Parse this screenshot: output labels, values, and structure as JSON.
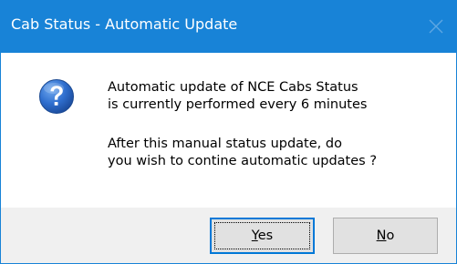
{
  "window": {
    "title": "Cab Status - Automatic Update"
  },
  "icons": {
    "close": "close-icon",
    "message": "question-icon"
  },
  "message": {
    "line1": "Automatic update of NCE Cabs Status",
    "line2": "is currently performed every 6 minutes",
    "line3": "After this manual status update, do",
    "line4": "you wish to contine automatic updates ?"
  },
  "buttons": {
    "yes_mnemonic": "Y",
    "yes_rest": "es",
    "no_mnemonic": "N",
    "no_rest": "o"
  },
  "colors": {
    "titlebar": "#1883d7",
    "footer": "#f0f0f0",
    "button_face": "#e1e1e1",
    "default_button_border": "#0078d7"
  }
}
